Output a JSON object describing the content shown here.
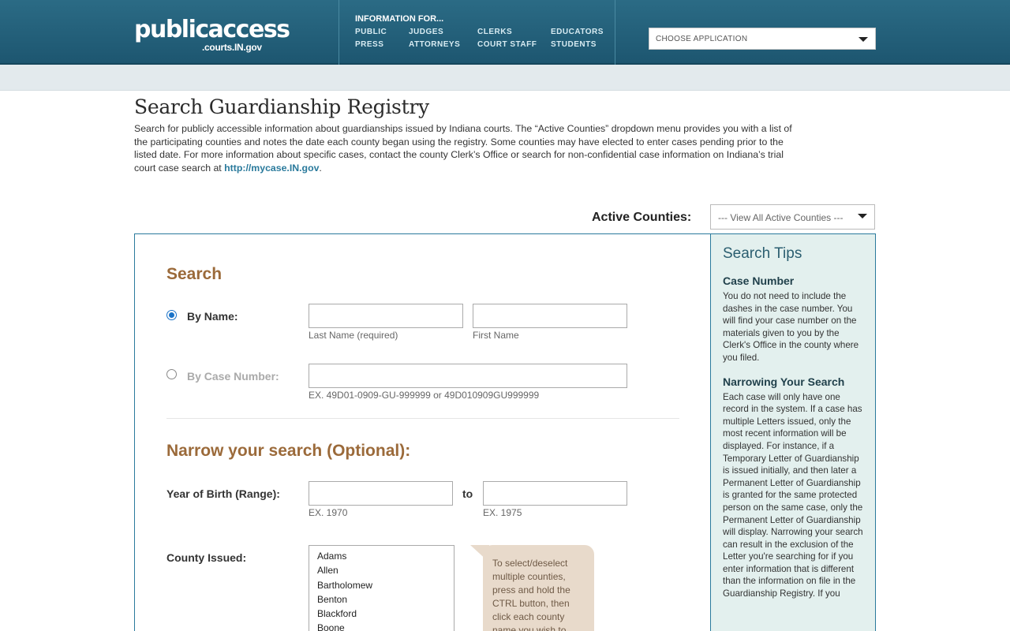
{
  "header": {
    "logo_main": "publicaccess",
    "logo_sub": ".courts.IN.gov",
    "info_title": "INFORMATION FOR...",
    "links": [
      "PUBLIC",
      "PRESS",
      "JUDGES",
      "ATTORNEYS",
      "CLERKS",
      "COURT STAFF",
      "EDUCATORS",
      "STUDENTS"
    ],
    "choose_app": "CHOOSE APPLICATION"
  },
  "page": {
    "title": "Search Guardianship Registry",
    "intro": "Search for publicly accessible information about guardianships issued by Indiana courts. The “Active Counties” dropdown menu provides you with a list of the participating counties and notes the date each county began using the registry. Some counties may have elected to enter cases pending prior to the listed date. For more information about specific cases, contact the county Clerk’s Office or search for non-confidential case information on Indiana’s trial court case search at",
    "intro_link": "http://mycase.IN.gov",
    "intro_end": ".",
    "active_counties_label": "Active Counties:",
    "active_counties_value": "--- View All Active Counties ---"
  },
  "search": {
    "title": "Search",
    "by_name_label": "By Name:",
    "last_name_hint": "Last Name (required)",
    "first_name_hint": "First Name",
    "by_case_label": "By Case Number:",
    "case_example": "EX. 49D01-0909-GU-999999 or 49D010909GU999999"
  },
  "narrow": {
    "title": "Narrow your search (Optional):",
    "yob_label": "Year of Birth (Range):",
    "to_label": "to",
    "yob_from_hint": "EX. 1970",
    "yob_to_hint": "EX. 1975",
    "county_label": "County Issued:",
    "counties": [
      "Adams",
      "Allen",
      "Bartholomew",
      "Benton",
      "Blackford",
      "Boone"
    ],
    "county_tip": "To select/deselect multiple counties, press and hold the CTRL button, then click each county name you wish to"
  },
  "tips": {
    "title": "Search Tips",
    "items": [
      {
        "heading": "Case Number",
        "text": "You do not need to include the dashes in the case number. You will find your case number on the materials given to you by the Clerk's Office in the county where you filed."
      },
      {
        "heading": "Narrowing Your Search",
        "text": "Each case will only have one record in the system. If a case has multiple Letters issued, only the most recent information will be displayed. For instance, if a Temporary Letter of Guardianship is issued initially, and then later a Permanent Letter of Guardianship is granted for the same protected person on the same case, only the Permanent Letter of Guardianship will display. Narrowing your search can result in the exclusion of the Letter you're searching for if you enter information that is different than the information on file in the Guardianship Registry. If you"
      }
    ]
  }
}
